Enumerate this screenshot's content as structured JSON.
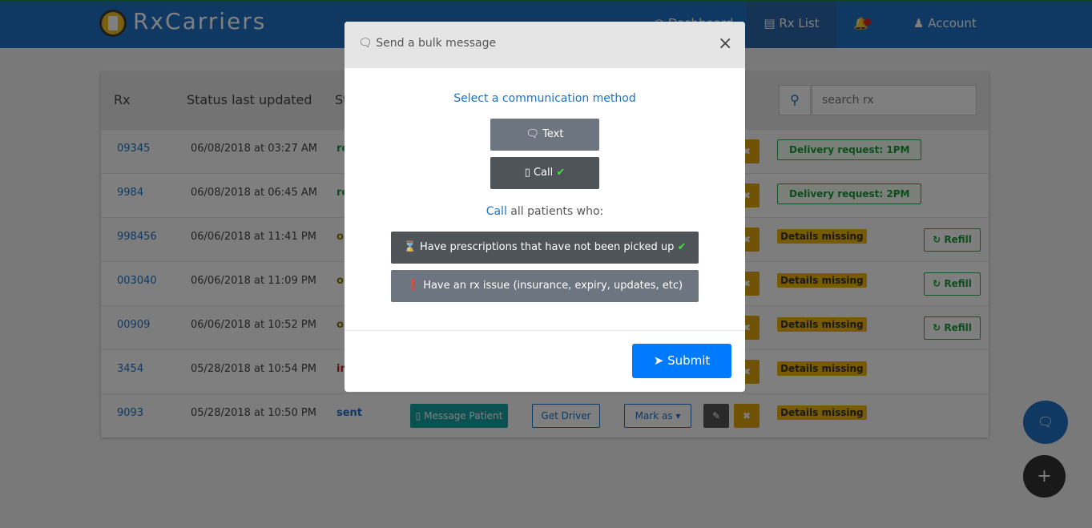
{
  "navbar": {
    "brand": "RxCarriers",
    "dashboard_label": "Dashboard",
    "rxlist_label": "Rx List",
    "account_label": "Account"
  },
  "table": {
    "headers": [
      "Rx",
      "Status last updated",
      "St"
    ],
    "search_placeholder": "search rx",
    "rows": [
      {
        "rx": "09345",
        "date": "06/08/2018 at 03:27 AM",
        "status": "re",
        "status_color": "#1a9a38",
        "badge": "Delivery request: 1PM",
        "badge_type": "delivery",
        "refill": ""
      },
      {
        "rx": "9984",
        "date": "06/08/2018 at 06:45 AM",
        "status": "re",
        "status_color": "#1a9a38",
        "badge": "Delivery request: 2PM",
        "badge_type": "delivery",
        "refill": ""
      },
      {
        "rx": "998456",
        "date": "06/06/2018 at 11:41 PM",
        "status": "or",
        "status_color": "#8a7a00",
        "badge": "Details missing",
        "badge_type": "missing",
        "refill": "Refill"
      },
      {
        "rx": "003040",
        "date": "06/06/2018 at 11:09 PM",
        "status": "or",
        "status_color": "#8a7a00",
        "badge": "Details missing",
        "badge_type": "missing",
        "refill": "Refill"
      },
      {
        "rx": "00909",
        "date": "06/06/2018 at 10:52 PM",
        "status": "or",
        "status_color": "#8a7a00",
        "badge": "Details missing",
        "badge_type": "missing",
        "refill": "Refill"
      },
      {
        "rx": "3454",
        "date": "05/28/2018 at 10:54 PM",
        "status": "in",
        "status_color": "#d02020",
        "badge": "Details missing",
        "badge_type": "missing",
        "refill": ""
      },
      {
        "rx": "9093",
        "date": "05/28/2018 at 10:50 PM",
        "status": "sent",
        "status_color": "#1f72c4",
        "badge": "Details missing",
        "badge_type": "missing",
        "refill": ""
      }
    ],
    "last_row_actions": {
      "message_label": "Message Patient",
      "driver_label": "Get Driver",
      "mark_label": "Mark as"
    }
  },
  "modal": {
    "title": "Send a bulk message",
    "select_heading": "Select a communication method",
    "text_label": "Text",
    "call_label": "Call",
    "who_method": "Call",
    "who_rest": "all patients who:",
    "condition_1": "Have prescriptions that have not been picked up",
    "condition_2": "Have an rx issue (insurance, expiry, updates, etc)",
    "submit_label": "Submit"
  },
  "colors": {
    "navbar": "#1f72c4",
    "primary": "#007bff",
    "warning": "#f0b400",
    "success": "#1a9a38"
  }
}
